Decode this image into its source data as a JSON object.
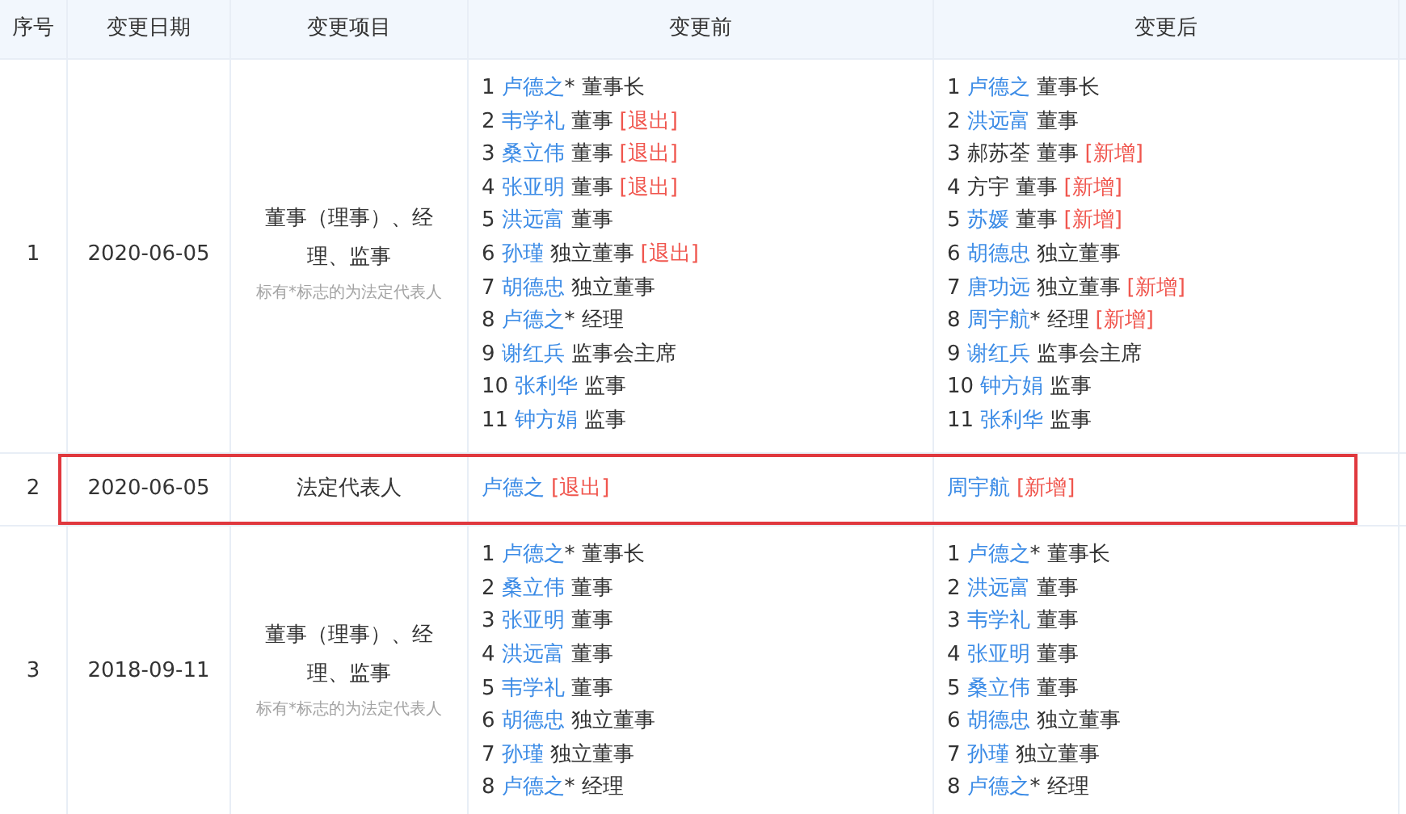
{
  "table": {
    "columns": [
      "序号",
      "变更日期",
      "变更项目",
      "变更前",
      "变更后"
    ],
    "rows": [
      {
        "index": "1",
        "date": "2020-06-05",
        "item": "董事（理事）、经理、监事",
        "note": "标有*标志的为法定代表人",
        "selected": false,
        "before": [
          {
            "num": "1",
            "name": "卢德之",
            "linked": true,
            "mark": "*",
            "role": "董事长"
          },
          {
            "num": "2",
            "name": "韦学礼",
            "linked": true,
            "role": "董事",
            "tag": "[退出]"
          },
          {
            "num": "3",
            "name": "桑立伟",
            "linked": true,
            "role": "董事",
            "tag": "[退出]"
          },
          {
            "num": "4",
            "name": "张亚明",
            "linked": true,
            "role": "董事",
            "tag": "[退出]"
          },
          {
            "num": "5",
            "name": "洪远富",
            "linked": true,
            "role": "董事"
          },
          {
            "num": "6",
            "name": "孙瑾",
            "linked": true,
            "role": "独立董事",
            "tag": "[退出]"
          },
          {
            "num": "7",
            "name": "胡德忠",
            "linked": true,
            "role": "独立董事"
          },
          {
            "num": "8",
            "name": "卢德之",
            "linked": true,
            "mark": "*",
            "role": "经理"
          },
          {
            "num": "9",
            "name": "谢红兵",
            "linked": true,
            "role": "监事会主席"
          },
          {
            "num": "10",
            "name": "张利华",
            "linked": true,
            "role": "监事"
          },
          {
            "num": "11",
            "name": "钟方娟",
            "linked": true,
            "role": "监事"
          }
        ],
        "after": [
          {
            "num": "1",
            "name": "卢德之",
            "linked": true,
            "role": "董事长"
          },
          {
            "num": "2",
            "name": "洪远富",
            "linked": true,
            "role": "董事"
          },
          {
            "num": "3",
            "name": "郝苏荃",
            "linked": false,
            "role": "董事",
            "tag": "[新增]"
          },
          {
            "num": "4",
            "name": "方宇",
            "linked": false,
            "role": "董事",
            "tag": "[新增]"
          },
          {
            "num": "5",
            "name": "苏媛",
            "linked": true,
            "role": "董事",
            "tag": "[新增]"
          },
          {
            "num": "6",
            "name": "胡德忠",
            "linked": true,
            "role": "独立董事"
          },
          {
            "num": "7",
            "name": "唐功远",
            "linked": true,
            "role": "独立董事",
            "tag": "[新增]"
          },
          {
            "num": "8",
            "name": "周宇航",
            "linked": true,
            "mark": "*",
            "role": "经理",
            "tag": "[新增]"
          },
          {
            "num": "9",
            "name": "谢红兵",
            "linked": true,
            "role": "监事会主席"
          },
          {
            "num": "10",
            "name": "钟方娟",
            "linked": true,
            "role": "监事"
          },
          {
            "num": "11",
            "name": "张利华",
            "linked": true,
            "role": "监事"
          }
        ]
      },
      {
        "index": "2",
        "date": "2020-06-05",
        "item": "法定代表人",
        "selected": true,
        "before": [
          {
            "name": "卢德之",
            "linked": true,
            "tag": "[退出]"
          }
        ],
        "after": [
          {
            "name": "周宇航",
            "linked": true,
            "tag": "[新增]"
          }
        ]
      },
      {
        "index": "3",
        "date": "2018-09-11",
        "item": "董事（理事）、经理、监事",
        "note": "标有*标志的为法定代表人",
        "selected": false,
        "before": [
          {
            "num": "1",
            "name": "卢德之",
            "linked": true,
            "mark": "*",
            "role": "董事长"
          },
          {
            "num": "2",
            "name": "桑立伟",
            "linked": true,
            "role": "董事"
          },
          {
            "num": "3",
            "name": "张亚明",
            "linked": true,
            "role": "董事"
          },
          {
            "num": "4",
            "name": "洪远富",
            "linked": true,
            "role": "董事"
          },
          {
            "num": "5",
            "name": "韦学礼",
            "linked": true,
            "role": "董事"
          },
          {
            "num": "6",
            "name": "胡德忠",
            "linked": true,
            "role": "独立董事"
          },
          {
            "num": "7",
            "name": "孙瑾",
            "linked": true,
            "role": "独立董事"
          },
          {
            "num": "8",
            "name": "卢德之",
            "linked": true,
            "mark": "*",
            "role": "经理"
          }
        ],
        "after": [
          {
            "num": "1",
            "name": "卢德之",
            "linked": true,
            "mark": "*",
            "role": "董事长"
          },
          {
            "num": "2",
            "name": "洪远富",
            "linked": true,
            "role": "董事"
          },
          {
            "num": "3",
            "name": "韦学礼",
            "linked": true,
            "role": "董事"
          },
          {
            "num": "4",
            "name": "张亚明",
            "linked": true,
            "role": "董事"
          },
          {
            "num": "5",
            "name": "桑立伟",
            "linked": true,
            "role": "董事"
          },
          {
            "num": "6",
            "name": "胡德忠",
            "linked": true,
            "role": "独立董事"
          },
          {
            "num": "7",
            "name": "孙瑾",
            "linked": true,
            "role": "独立董事"
          },
          {
            "num": "8",
            "name": "卢德之",
            "linked": true,
            "mark": "*",
            "role": "经理"
          }
        ]
      }
    ]
  }
}
